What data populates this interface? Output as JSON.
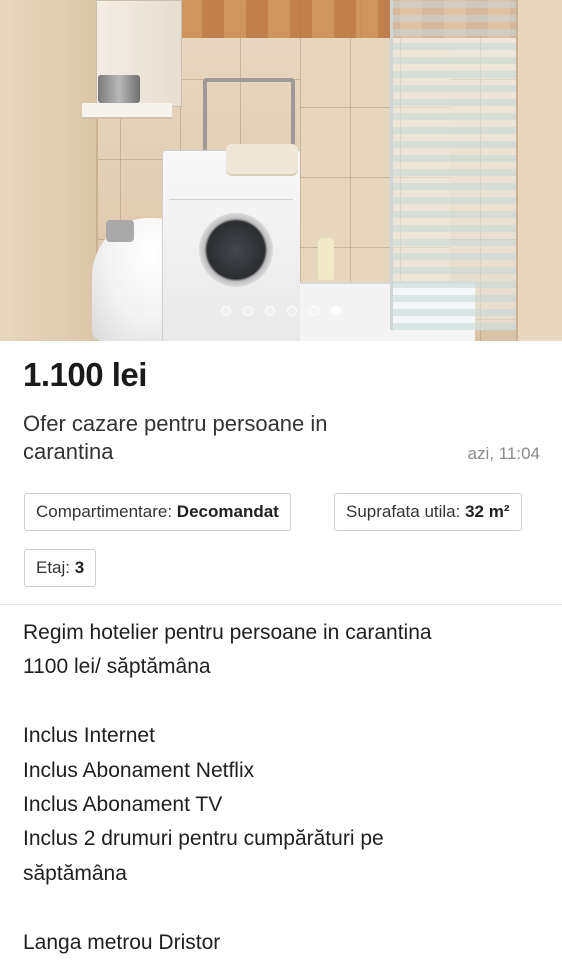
{
  "gallery": {
    "image_alt": "bathroom photo",
    "dots_count": 6,
    "active_index": 5
  },
  "listing": {
    "price": "1.100 lei",
    "title": "Ofer cazare pentru persoane in carantina",
    "posted": "azi, 11:04"
  },
  "attributes": [
    {
      "label": "Compartimentare:",
      "value": "Decomandat"
    },
    {
      "label": "Suprafata utila:",
      "value": "32 m²"
    },
    {
      "label": "Etaj:",
      "value": "3"
    }
  ],
  "description": {
    "lines": [
      "Regim hotelier pentru persoane in carantina",
      "1100 lei/ săptămâna",
      "",
      "Inclus Internet",
      "Inclus Abonament Netflix",
      "Inclus Abonament TV",
      "Inclus 2 drumuri pentru cumpărături pe",
      "săptămâna",
      "",
      "Langa metrou Dristor"
    ]
  }
}
